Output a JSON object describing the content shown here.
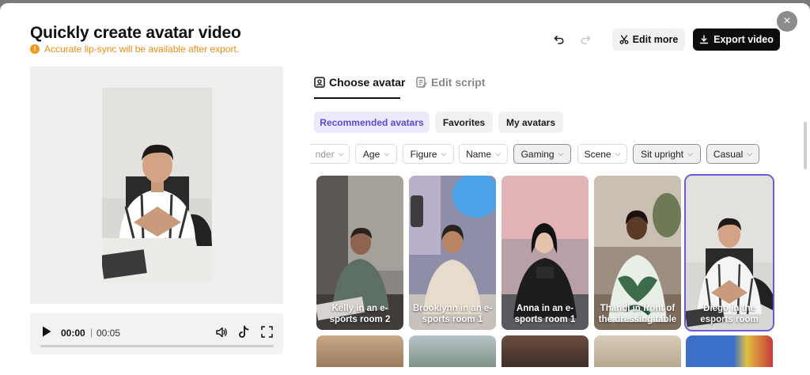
{
  "dialog": {
    "title": "Quickly create avatar video",
    "notice": "Accurate lip-sync will be available after export.",
    "notice_icon": "!",
    "close_icon": "×"
  },
  "toolbar": {
    "edit_more_label": "Edit more",
    "export_label": "Export video"
  },
  "player": {
    "current_time": "00:00",
    "separator": "|",
    "duration": "00:05",
    "progress": 0
  },
  "tabs": [
    {
      "label": "Choose avatar",
      "active": true
    },
    {
      "label": "Edit script",
      "active": false
    }
  ],
  "categories": [
    {
      "label": "Recommended avatars",
      "active": true
    },
    {
      "label": "Favorites",
      "active": false
    },
    {
      "label": "My avatars",
      "active": false
    }
  ],
  "filters": [
    {
      "label": "nder",
      "selected": false
    },
    {
      "label": "Age",
      "selected": false
    },
    {
      "label": "Figure",
      "selected": false
    },
    {
      "label": "Name",
      "selected": false
    },
    {
      "label": "Gaming",
      "selected": true
    },
    {
      "label": "Scene",
      "selected": false
    },
    {
      "label": "Sit upright",
      "selected": true
    },
    {
      "label": "Casual",
      "selected": true
    }
  ],
  "avatars": [
    {
      "label": "Kelly in an e-sports room 2",
      "selected": false
    },
    {
      "label": "Brooklynn in an e-sports room 1",
      "selected": false
    },
    {
      "label": "Anna in an e-sports room 1",
      "selected": false
    },
    {
      "label": "Thandi in front of the dressing table",
      "selected": false
    },
    {
      "label": "Diego in the esports room",
      "selected": true
    }
  ],
  "colors": {
    "accent": "#6a5ae0",
    "notice": "#f08a12",
    "export_bg": "#0d0d0d"
  }
}
